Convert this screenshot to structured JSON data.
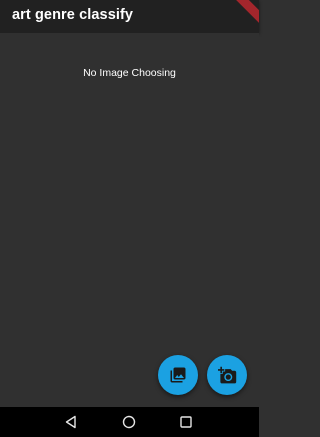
{
  "app_bar": {
    "title": "art genre classify"
  },
  "main": {
    "status_text": "No Image Choosing"
  },
  "fabs": [
    {
      "icon": "photo-library-icon"
    },
    {
      "icon": "add-a-photo-icon"
    }
  ],
  "nav": {
    "back_icon": "back-triangle-icon",
    "home_icon": "home-circle-icon",
    "recents_icon": "recents-square-icon"
  },
  "colors": {
    "app_bar": "#212121",
    "background": "#303030",
    "fab": "#1ba1e2",
    "debug_banner": "#a3262c",
    "nav_bar": "#000000"
  }
}
